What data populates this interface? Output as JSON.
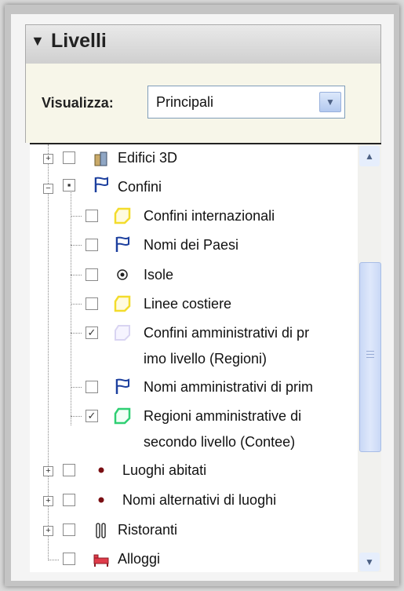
{
  "panel": {
    "title": "Livelli",
    "filter_label": "Visualizza:",
    "filter_value": "Principali"
  },
  "tree": {
    "items": [
      {
        "label": "Edifici 3D",
        "checked": false,
        "icon": "building-icon"
      },
      {
        "label": "Confini",
        "checked": "partial",
        "icon": "flag-icon",
        "expanded": true,
        "selected": true
      },
      {
        "label": "Confini internazionali",
        "checked": false,
        "icon": "polygon-yellow-icon"
      },
      {
        "label": "Nomi dei Paesi",
        "checked": false,
        "icon": "flag-icon"
      },
      {
        "label": "Isole",
        "checked": false,
        "icon": "target-dot-icon"
      },
      {
        "label": "Linee costiere",
        "checked": false,
        "icon": "polygon-yellow-icon"
      },
      {
        "label": "Confini amministrativi di pr",
        "label2": "imo livello (Regioni)",
        "checked": true,
        "icon": "polygon-lavender-icon"
      },
      {
        "label": "Nomi amministrativi di prim",
        "checked": false,
        "icon": "flag-icon"
      },
      {
        "label": "Regioni amministrative di",
        "label2": "secondo livello (Contee)",
        "checked": true,
        "icon": "polygon-green-icon"
      },
      {
        "label": "Luoghi abitati",
        "checked": false,
        "icon": "red-dot-icon"
      },
      {
        "label": "Nomi alternativi di luoghi",
        "checked": false,
        "icon": "red-dot-icon"
      },
      {
        "label": "Ristoranti",
        "checked": false,
        "icon": "cutlery-icon"
      },
      {
        "label": "Alloggi",
        "checked": false,
        "icon": "bed-icon"
      }
    ]
  },
  "colors": {
    "header_bg": "#d6d6d6",
    "filter_bg": "#f7f6e9",
    "select_border": "#7f9db9",
    "scroll_thumb": "#c9d8f6"
  }
}
